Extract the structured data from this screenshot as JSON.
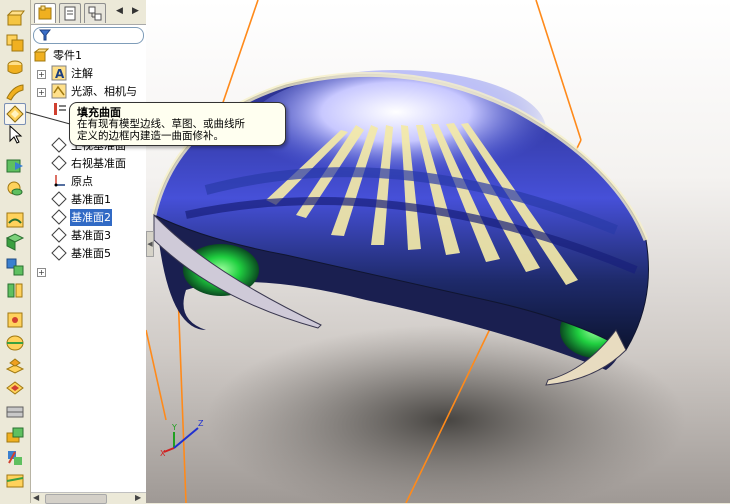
{
  "feature_tree": {
    "root": {
      "label": "零件1",
      "icon": "part-icon"
    },
    "items": [
      {
        "label": "注解",
        "icon": "annotation-icon",
        "expandable": true
      },
      {
        "label": "光源、相机与",
        "icon": "lights-cameras-icon",
        "expandable": true
      },
      {
        "label": "上视基准面",
        "icon": "plane-icon",
        "expandable": false
      },
      {
        "label": "右视基准面",
        "icon": "plane-icon",
        "expandable": false
      },
      {
        "label": "原点",
        "icon": "origin-icon",
        "expandable": false
      },
      {
        "label": "基准面1",
        "icon": "plane-icon",
        "expandable": false
      },
      {
        "label": "基准面2",
        "icon": "plane-icon",
        "expandable": false,
        "selected": true
      },
      {
        "label": "基准面3",
        "icon": "plane-icon",
        "expandable": false
      },
      {
        "label": "基准面5",
        "icon": "plane-icon",
        "expandable": false
      }
    ]
  },
  "tooltip": {
    "title": "填充曲面",
    "line1": "在有现有模型边线、草图、或曲线所",
    "line2": "定义的边框内建造一曲面修补。"
  },
  "toolbar_icons": [
    "extrude-surface-icon",
    "revolve-surface-icon",
    "sweep-surface-icon",
    "loft-surface-icon",
    "fill-surface-icon",
    "pointer-icon",
    "offset-surface-icon",
    "radiate-surface-icon",
    "planar-surface-icon",
    "knit-surface-icon",
    "extend-surface-icon",
    "trim-surface-icon",
    "fillet-icon",
    "mid-surface-icon",
    "delete-face-icon",
    "replace-face-icon",
    "ruled-surface-icon",
    "thicken-icon",
    "move-copy-icon",
    "cut-with-surface-icon"
  ],
  "colors": {
    "selection": "#316ac5",
    "plane_edge": "#ff8a1a",
    "tooltip_bg": "#fffff0"
  }
}
